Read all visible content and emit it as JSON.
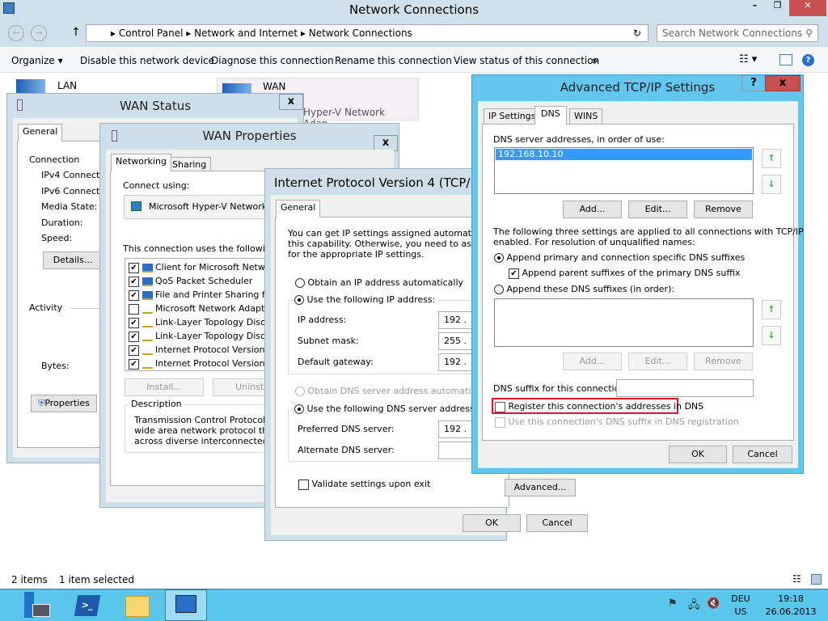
{
  "explorer": {
    "title": "Network Connections",
    "breadcrumb": [
      "Control Panel",
      "Network and Internet",
      "Network Connections"
    ],
    "search_placeholder": "Search Network Connections",
    "toolbar": [
      "Organize",
      "Disable this network device",
      "Diagnose this connection",
      "Rename this connection",
      "View status of this connection",
      "»"
    ],
    "items": [
      {
        "name": "LAN"
      },
      {
        "name": "WAN",
        "subtitle": "Hyper-V Network Adap..."
      }
    ],
    "status": {
      "count": "2 items",
      "selected": "1 item selected"
    }
  },
  "wan_status": {
    "title": "WAN Status",
    "close": "x",
    "tab": "General",
    "connection_label": "Connection",
    "fields": [
      "IPv4 Connectiv",
      "IPv6 Connectiv",
      "Media State:",
      "Duration:",
      "Speed:"
    ],
    "details_button": "Details...",
    "activity_label": "Activity",
    "bytes_label": "Bytes:",
    "properties_button": "Properties"
  },
  "wan_properties": {
    "title": "WAN Properties",
    "close": "x",
    "tabs": [
      "Networking",
      "Sharing"
    ],
    "connect_using_label": "Connect using:",
    "adapter": "Microsoft Hyper-V Network Ad",
    "items_label": "This connection uses the following ite",
    "items": [
      {
        "label": "Client for Microsoft Network",
        "checked": true
      },
      {
        "label": "QoS Packet Scheduler",
        "checked": true
      },
      {
        "label": "File and Printer Sharing for M",
        "checked": true
      },
      {
        "label": "Microsoft Network Adapter I",
        "checked": false
      },
      {
        "label": "Link-Layer Topology Discov",
        "checked": true
      },
      {
        "label": "Link-Layer Topology Discov",
        "checked": true
      },
      {
        "label": "Internet Protocol Version 6 (",
        "checked": true
      },
      {
        "label": "Internet Protocol Version 4 (",
        "checked": true
      }
    ],
    "install_button": "Install...",
    "uninstall_button": "Uninsta",
    "description_label": "Description",
    "description": [
      "Transmission Control Protocol/Inte",
      "wide area network protocol that pr",
      "across diverse interconnected net"
    ]
  },
  "ipv4": {
    "title": "Internet Protocol Version 4 (TCP/IPv4)",
    "tab": "General",
    "intro": [
      "You can get IP settings assigned automatically i",
      "this capability. Otherwise, you need to ask your",
      "for the appropriate IP settings."
    ],
    "obtain_ip": "Obtain an IP address automatically",
    "use_ip": "Use the following IP address:",
    "ip_label": "IP address:",
    "ip_value": "192  .",
    "mask_label": "Subnet mask:",
    "mask_value": "255  .",
    "gateway_label": "Default gateway:",
    "gateway_value": "192  .",
    "obtain_dns": "Obtain DNS server address automatically",
    "use_dns": "Use the following DNS server addresses:",
    "preferred_label": "Preferred DNS server:",
    "preferred_value": "192  .",
    "alternate_label": "Alternate DNS server:",
    "alternate_value": ".",
    "validate": "Validate settings upon exit",
    "advanced_button": "Advanced...",
    "ok": "OK",
    "cancel": "Cancel"
  },
  "advanced": {
    "title": "Advanced TCP/IP Settings",
    "help": "?",
    "close": "x",
    "tabs": [
      "IP Settings",
      "DNS",
      "WINS"
    ],
    "dns_list_label": "DNS server addresses, in order of use:",
    "dns_servers": [
      "192.168.10.10"
    ],
    "add": "Add...",
    "edit": "Edit...",
    "remove": "Remove",
    "info": [
      "The following three settings are applied to all connections with TCP/IP",
      "enabled. For resolution of unqualified names:"
    ],
    "append_primary": "Append primary and connection specific DNS suffixes",
    "append_parent": "Append parent suffixes of the primary DNS suffix",
    "append_these": "Append these DNS suffixes (in order):",
    "add2": "Add...",
    "edit2": "Edit...",
    "remove2": "Remove",
    "suffix_label": "DNS suffix for this connection:",
    "suffix_value": "",
    "register": "Register this connection's addresses in DNS",
    "use_suffix": "Use this connection's DNS suffix in DNS registration",
    "ok": "OK",
    "cancel": "Cancel",
    "highlight_color": "#e81123"
  },
  "taskbar": {
    "lang": "DEU",
    "layout": "US",
    "time": "19:18",
    "date": "26.06.2013",
    "color": "#5bc6ec"
  }
}
